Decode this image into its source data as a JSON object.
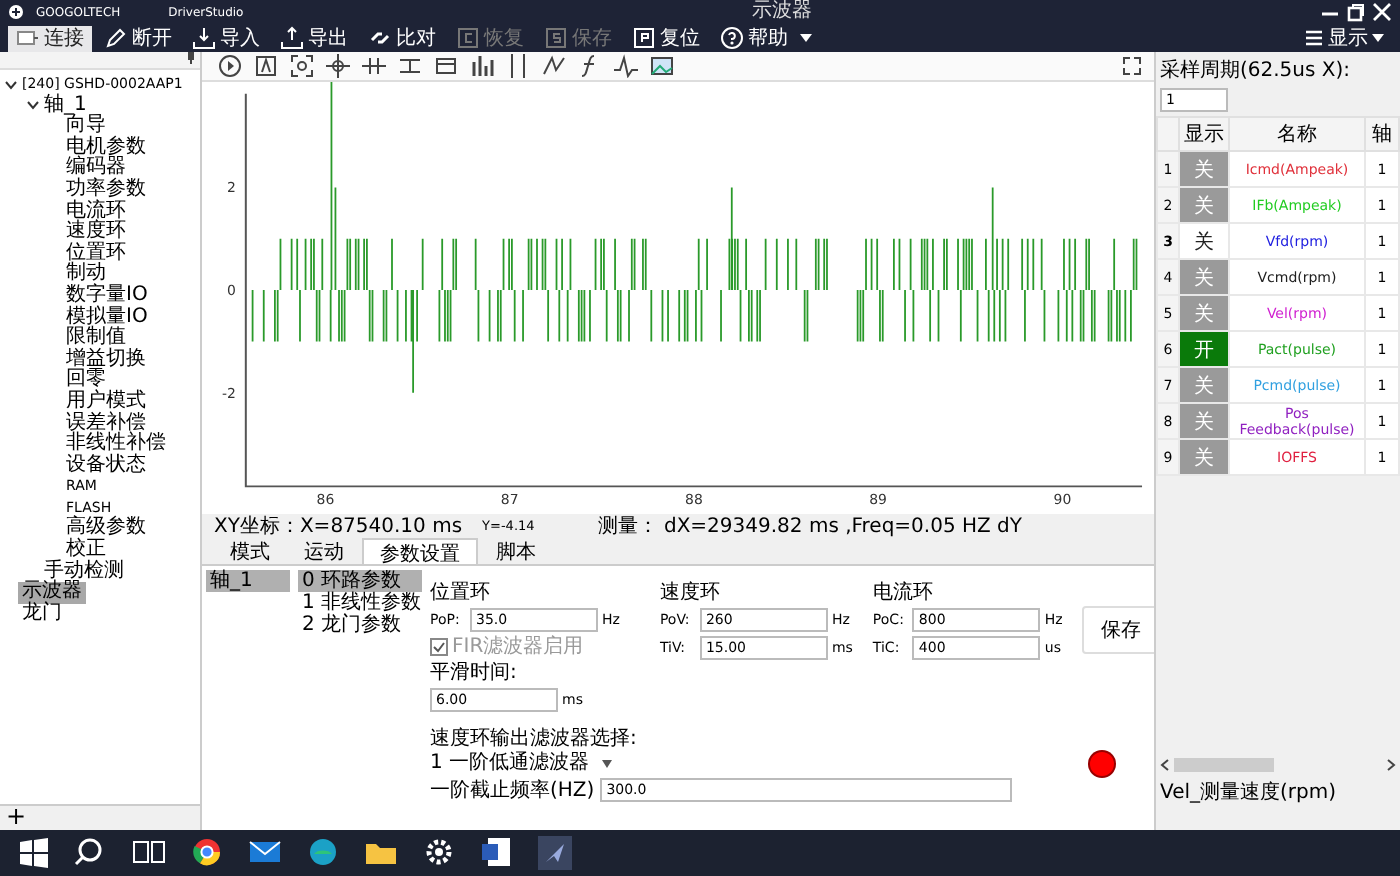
{
  "window": {
    "brand": "GOOGOLTECH",
    "app_name": "DriverStudio",
    "title": "示波器"
  },
  "toolbar": [
    {
      "kind": "connect",
      "label": "连接",
      "selected": true,
      "disabled": false
    },
    {
      "kind": "disconnect",
      "label": "断开",
      "selected": false,
      "disabled": false
    },
    {
      "kind": "import",
      "label": "导入",
      "selected": false,
      "disabled": false
    },
    {
      "kind": "export",
      "label": "导出",
      "selected": false,
      "disabled": false
    },
    {
      "kind": "compare",
      "label": "比对",
      "selected": false,
      "disabled": false
    },
    {
      "kind": "restore",
      "label": "恢复",
      "selected": false,
      "disabled": true
    },
    {
      "kind": "save",
      "label": "保存",
      "selected": false,
      "disabled": true
    },
    {
      "kind": "reset",
      "label": "复位",
      "selected": false,
      "disabled": false
    },
    {
      "kind": "help",
      "label": "帮助",
      "selected": false,
      "disabled": false
    }
  ],
  "view_menu": {
    "label": "显示"
  },
  "tree": [
    {
      "label": "[240] GSHD-0002AAP1",
      "expanded": true,
      "selected": false,
      "children": [
        {
          "label": "轴_1",
          "expanded": true,
          "selected": false,
          "children": [
            {
              "label": "向导",
              "selected": false
            },
            {
              "label": "电机参数",
              "selected": false
            },
            {
              "label": "编码器",
              "selected": false
            },
            {
              "label": "功率参数",
              "selected": false
            },
            {
              "label": "电流环",
              "selected": false
            },
            {
              "label": "速度环",
              "selected": false
            },
            {
              "label": "位置环",
              "selected": false
            },
            {
              "label": "制动",
              "selected": false
            },
            {
              "label": "数字量IO",
              "selected": false
            },
            {
              "label": "模拟量IO",
              "selected": false
            },
            {
              "label": "限制值",
              "selected": false
            },
            {
              "label": "增益切换",
              "selected": false
            },
            {
              "label": "回零",
              "selected": false
            },
            {
              "label": "用户模式",
              "selected": false
            },
            {
              "label": "误差补偿",
              "selected": false
            },
            {
              "label": "非线性补偿",
              "selected": false
            },
            {
              "label": "设备状态",
              "selected": false
            },
            {
              "label": "RAM",
              "selected": false
            },
            {
              "label": "FLASH",
              "selected": false
            },
            {
              "label": "高级参数",
              "selected": false
            },
            {
              "label": "校正",
              "selected": false
            }
          ]
        },
        {
          "label": "手动检测",
          "selected": false
        }
      ]
    },
    {
      "label": "示波器",
      "selected": true
    },
    {
      "label": "龙门",
      "selected": false
    }
  ],
  "add_button": "+",
  "scope": {
    "y_ticks": [
      "2",
      "0",
      "-2"
    ],
    "x_ticks": [
      "86",
      "87",
      "88",
      "89",
      "90"
    ],
    "cursor_x": "XY坐标：X=87540.10 ms",
    "cursor_y": "Y=-4.14",
    "measurement": "测量： dX=29349.82 ms ,Freq=0.05 HZ dY"
  },
  "parameters": {
    "tabs": [
      {
        "label": "模式",
        "selected": false
      },
      {
        "label": "运动",
        "selected": false
      },
      {
        "label": "参数设置",
        "selected": true
      },
      {
        "label": "脚本",
        "selected": false
      }
    ],
    "axes": [
      {
        "label": "轴_1",
        "selected": true
      }
    ],
    "categories": [
      {
        "label": "0 环路参数",
        "selected": true
      },
      {
        "label": "1 非线性参数",
        "selected": false
      },
      {
        "label": "2 龙门参数",
        "selected": false
      }
    ],
    "position_loop": {
      "title": "位置环",
      "fields": [
        {
          "label": "PoP:",
          "value": "35.0",
          "unit": "Hz"
        }
      ]
    },
    "fir_filter": {
      "label": "FIR滤波器启用",
      "checked": true,
      "disabled": true
    },
    "smoothing": {
      "label": "平滑时间:",
      "value": "6.00",
      "unit": "ms"
    },
    "velocity_loop": {
      "title": "速度环",
      "fields": [
        {
          "label": "PoV:",
          "value": "260",
          "unit": "Hz"
        },
        {
          "label": "TiV:",
          "value": "15.00",
          "unit": "ms"
        }
      ]
    },
    "current_loop": {
      "title": "电流环",
      "fields": [
        {
          "label": "PoC:",
          "value": "800",
          "unit": "Hz"
        },
        {
          "label": "TiC:",
          "value": "400",
          "unit": "us"
        }
      ]
    },
    "save_button": "保存",
    "output_filter": {
      "label": "速度环输出滤波器选择:",
      "value": "1 一阶低通滤波器",
      "cutoff_label": "一阶截止频率(HZ)",
      "cutoff_value": "300.0"
    },
    "alarm_on": true
  },
  "channels": {
    "sampling_label": "采样周期(62.5us X):",
    "sampling_value": "1",
    "columns": [
      "显示",
      "名称",
      "轴"
    ],
    "rows": [
      {
        "number": "1",
        "display": "关",
        "on": false,
        "selected": false,
        "name": "Icmd(Ampeak)",
        "color": "#e0303a",
        "axis": "1"
      },
      {
        "number": "2",
        "display": "关",
        "on": false,
        "selected": false,
        "name": "IFb(Ampeak)",
        "color": "#22cc22",
        "axis": "1"
      },
      {
        "number": "3",
        "display": "关",
        "on": false,
        "selected": true,
        "name": "Vfd(rpm)",
        "color": "#2020e0",
        "axis": "1"
      },
      {
        "number": "4",
        "display": "关",
        "on": false,
        "selected": false,
        "name": "Vcmd(rpm)",
        "color": "#202020",
        "axis": "1"
      },
      {
        "number": "5",
        "display": "关",
        "on": false,
        "selected": false,
        "name": "Vel(rpm)",
        "color": "#d020d0",
        "axis": "1"
      },
      {
        "number": "6",
        "display": "开",
        "on": true,
        "selected": false,
        "name": "Pact(pulse)",
        "color": "#20a020",
        "axis": "1"
      },
      {
        "number": "7",
        "display": "关",
        "on": false,
        "selected": false,
        "name": "Pcmd(pulse)",
        "color": "#30a0e0",
        "axis": "1"
      },
      {
        "number": "8",
        "display": "关",
        "on": false,
        "selected": false,
        "name": "Pos Feedback(pulse)",
        "color": "#9020c0",
        "axis": "1"
      },
      {
        "number": "9",
        "display": "关",
        "on": false,
        "selected": false,
        "name": "IOFFS",
        "color": "#e02040",
        "axis": "1"
      }
    ],
    "legend": "Vel_测量速度(rpm)"
  }
}
